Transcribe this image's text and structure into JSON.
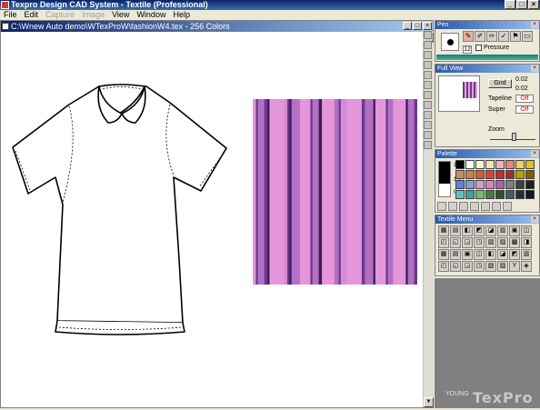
{
  "app": {
    "title": "Texpro Design CAD System - Textile (Professional)",
    "controls": [
      "_",
      "□",
      "×"
    ]
  },
  "menu": {
    "items": [
      {
        "label": "File",
        "enabled": true
      },
      {
        "label": "Edit",
        "enabled": true
      },
      {
        "label": "Capture",
        "enabled": false
      },
      {
        "label": "Image",
        "enabled": false
      },
      {
        "label": "View",
        "enabled": true
      },
      {
        "label": "Window",
        "enabled": true
      },
      {
        "label": "Help",
        "enabled": true
      }
    ]
  },
  "document": {
    "title": "C:\\Wnew Auto demo\\WTexProW\\fashionW4.tex - 256 Colors",
    "controls": [
      "_",
      "□",
      "×"
    ]
  },
  "fabric": {
    "stripe_colors": [
      "#e596d9",
      "#6b3a8f",
      "#b270c5",
      "#3d1c5a",
      "#d38cd5"
    ]
  },
  "pen_panel": {
    "title": "Pen",
    "size": "12",
    "pressure_label": "Pressure",
    "pressure_checked": false
  },
  "fullview_panel": {
    "title": "Full View",
    "grid_label": "Grid",
    "grid_values": [
      "0.02",
      "0.02"
    ],
    "tapeline_label": "Tapeline",
    "tapeline_value": "Off",
    "super_label": "Super",
    "super_value": "Off",
    "zoom_label": "Zoom"
  },
  "palette_panel": {
    "title": "Palette",
    "index_top": "1",
    "index_mid": "15",
    "index_bottom": "0",
    "swatches": [
      "#000000",
      "#ffffff",
      "#f8f8d0",
      "#f0e8b0",
      "#f0b0c0",
      "#f08080",
      "#f0d060",
      "#e0c020",
      "#c09060",
      "#d08040",
      "#d06030",
      "#e04040",
      "#c03030",
      "#a03030",
      "#c0a000",
      "#806000",
      "#6080e0",
      "#80a0e0",
      "#d0a0d0",
      "#e080c0",
      "#b060b0",
      "#808080",
      "#404040",
      "#202020",
      "#60c0c0",
      "#40a0a0",
      "#70c070",
      "#408040",
      "#305030",
      "#406060",
      "#203040",
      "#101820"
    ]
  },
  "textile_menu": {
    "title": "Textile Menu"
  },
  "brand": {
    "small": "YOUNG",
    "large": "TexPro"
  }
}
